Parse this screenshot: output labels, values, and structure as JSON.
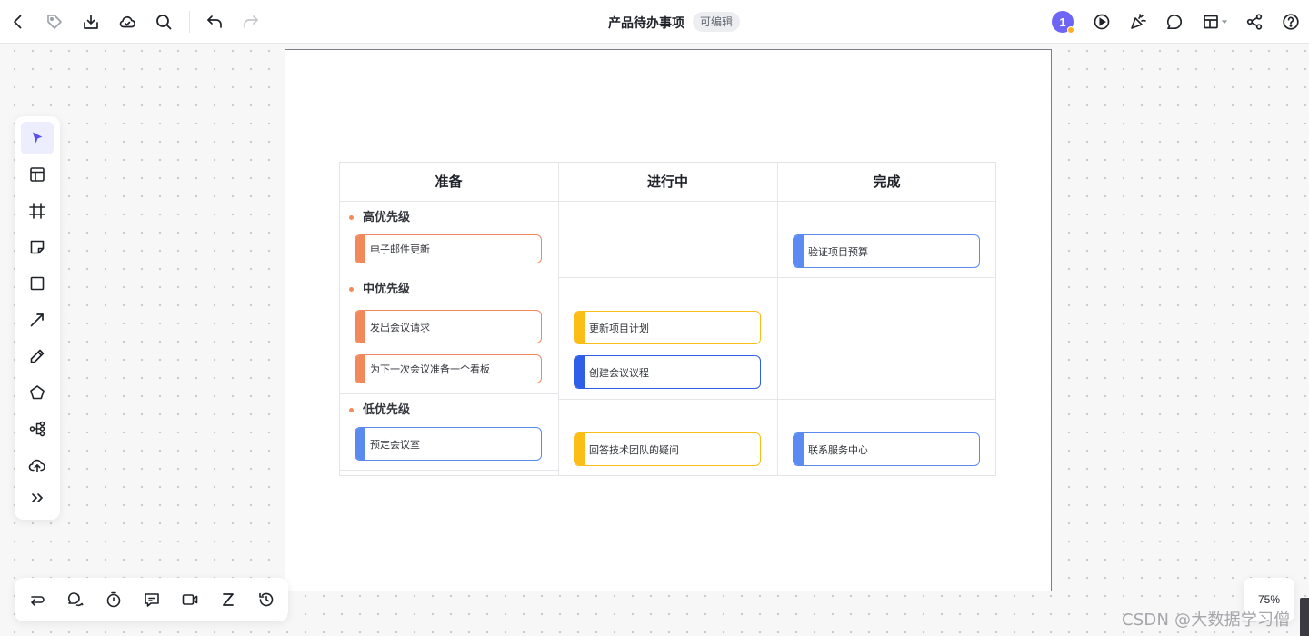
{
  "header": {
    "doc_title": "产品待办事项",
    "edit_badge": "可编辑",
    "avatar_initial": "1"
  },
  "toolbar_icons": {
    "left": [
      "back-icon",
      "tag-icon",
      "download-icon",
      "cloud-icon",
      "search-icon",
      "undo-icon",
      "redo-icon"
    ],
    "right": [
      "play-icon",
      "celebrate-icon",
      "comment-icon",
      "layout-icon",
      "share-icon",
      "help-icon"
    ]
  },
  "left_tools": [
    "select-icon",
    "template-icon",
    "frame-icon",
    "sticky-note-icon",
    "rectangle-icon",
    "arrow-icon",
    "pen-icon",
    "polygon-icon",
    "mindmap-icon",
    "upload-icon",
    "more-icon"
  ],
  "bottom_tools": [
    "switch-icon",
    "chat-bubbles-icon",
    "timer-icon",
    "message-icon",
    "video-icon",
    "z-icon",
    "history-icon"
  ],
  "board": {
    "columns": [
      "准备",
      "进行中",
      "完成"
    ],
    "lanes": [
      "高优先级",
      "中优先级",
      "低优先级"
    ],
    "cards": {
      "high_prep": "电子邮件更新",
      "high_done": "验证项目预算",
      "mid_prep_1": "发出会议请求",
      "mid_prep_2": "为下一次会议准备一个看板",
      "mid_prog_1": "更新项目计划",
      "mid_prog_2": "创建会议议程",
      "low_prep": "预定会议室",
      "low_prog": "回答技术团队的疑问",
      "low_done": "联系服务中心"
    }
  },
  "colors": {
    "accent": "#6e65f5",
    "orange": "#f2895c",
    "yellow": "#fbbd16",
    "blue": "#5b8bf0",
    "dark_blue": "#2f5ee8"
  },
  "zoom": "75%",
  "watermark": "CSDN @大数据学习僧"
}
